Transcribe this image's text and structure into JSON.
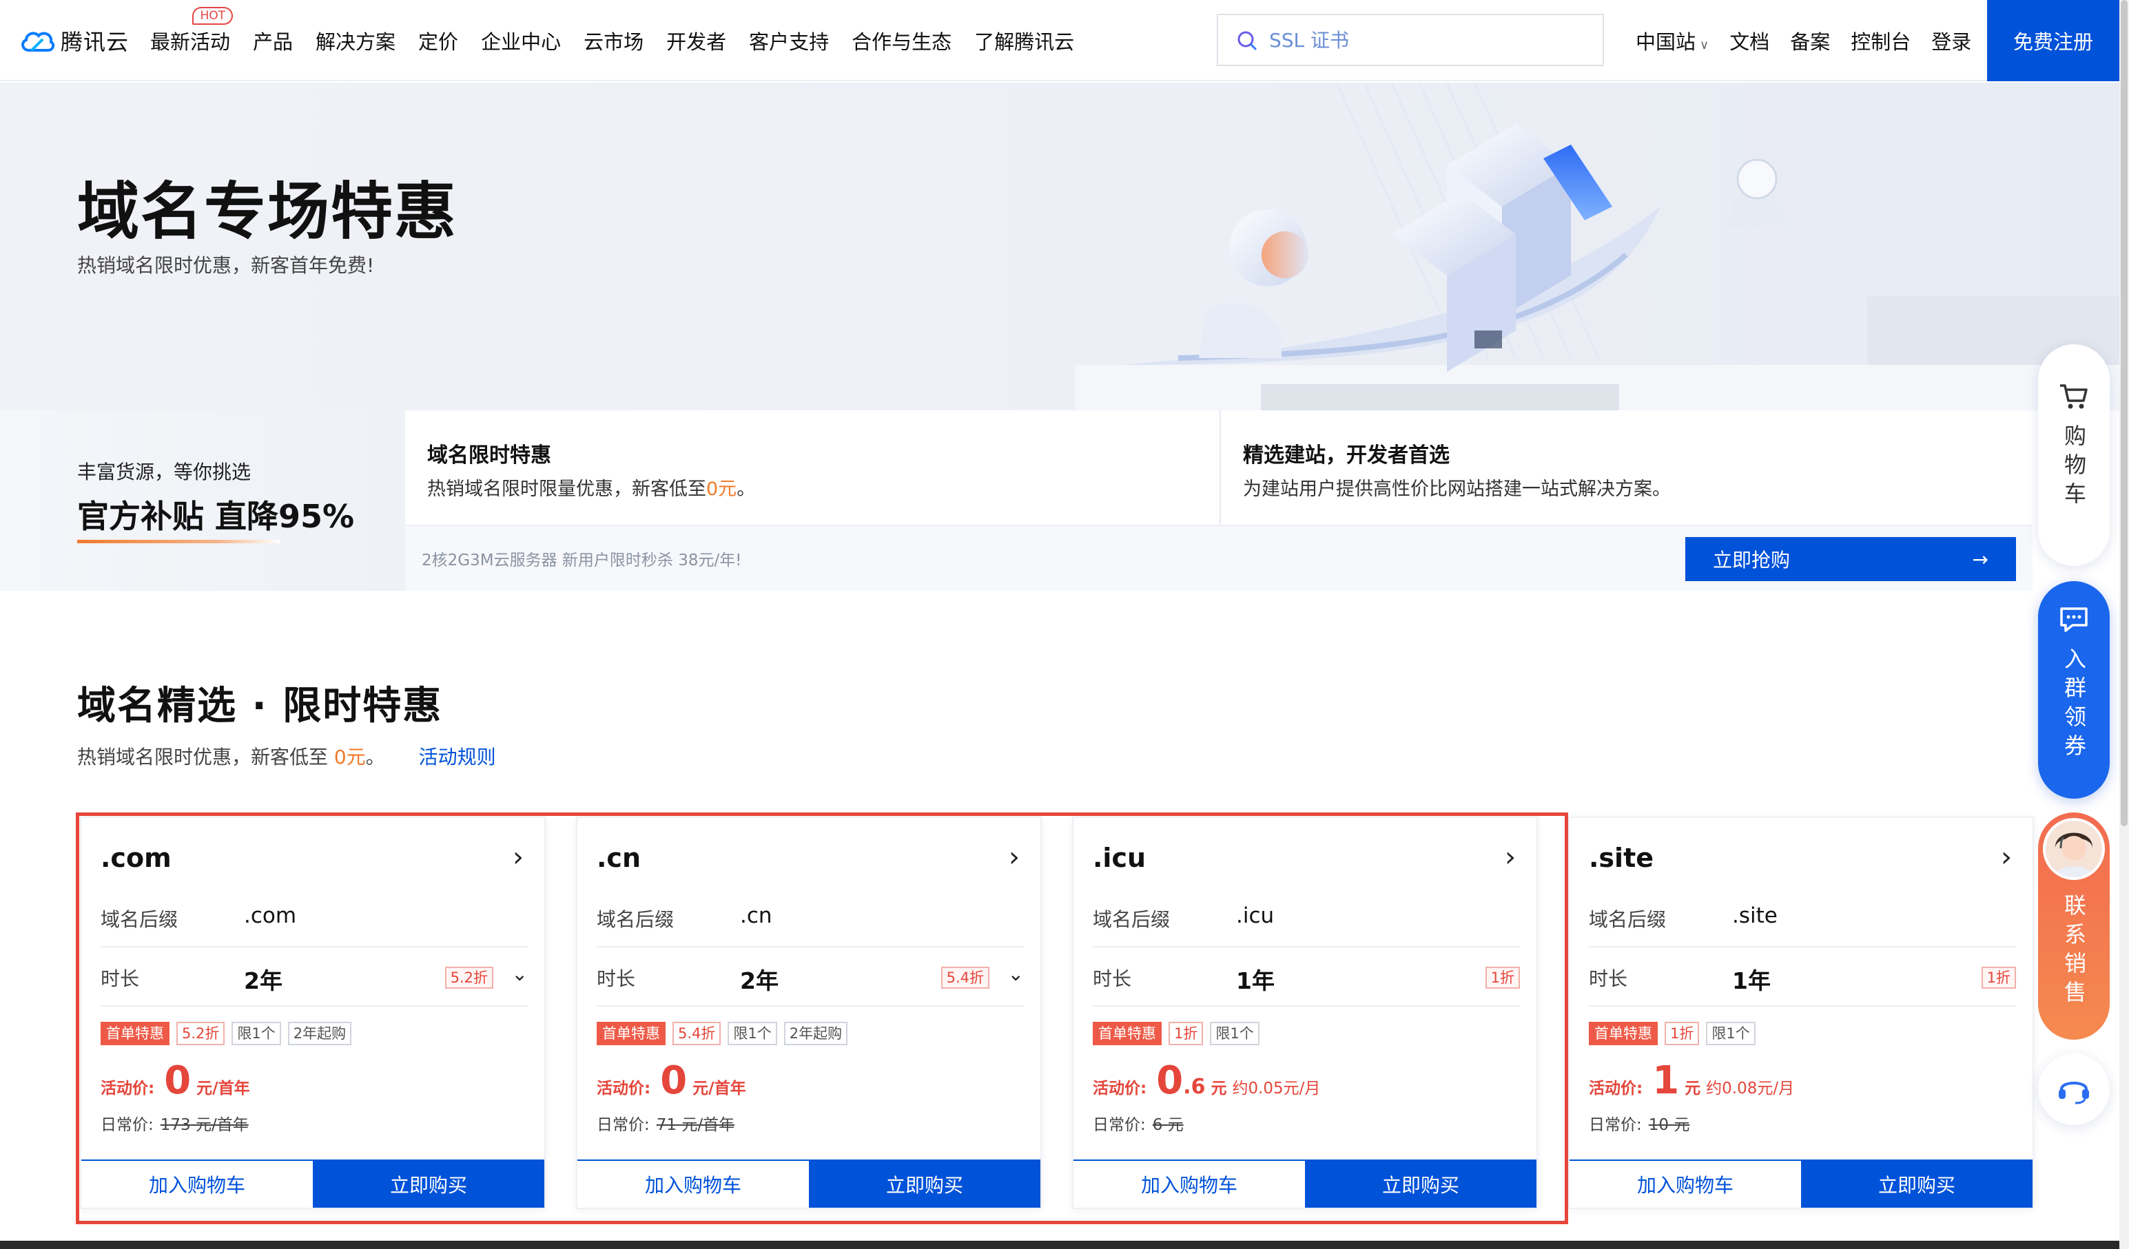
{
  "header": {
    "logo_text": "腾讯云",
    "nav": [
      "最新活动",
      "产品",
      "解决方案",
      "定价",
      "企业中心",
      "云市场",
      "开发者",
      "客户支持",
      "合作与生态",
      "了解腾讯云"
    ],
    "hot_badge": "HOT",
    "search_placeholder": "SSL 证书",
    "region": "中国站",
    "docs": "文档",
    "beian": "备案",
    "console": "控制台",
    "login": "登录",
    "register": "免费注册"
  },
  "banner": {
    "title": "域名专场特惠",
    "subtitle": "热销域名限时优惠，新客首年免费!"
  },
  "strip": {
    "left_small": "丰富货源，等你挑选",
    "left_big": "官方补贴 直降95%",
    "promo1_title": "域名限时特惠",
    "promo1_desc_pre": "热销域名限时限量优惠，新客低至",
    "promo1_desc_hl": "0元",
    "promo1_desc_post": "。",
    "promo2_title": "精选建站，开发者首选",
    "promo2_desc": "为建站用户提供高性价比网站搭建一站式解决方案。",
    "flash_text": "2核2G3M云服务器 新用户限时秒杀 38元/年!",
    "flash_btn": "立即抢购",
    "flash_arrow": "→"
  },
  "section": {
    "title": "域名精选 · 限时特惠",
    "sub_pre": "热销域名限时优惠，新客低至",
    "sub_hl": "0元",
    "sub_post": "。",
    "rules_link": "活动规则"
  },
  "labels": {
    "suffix": "域名后缀",
    "duration": "时长",
    "activity_price": "活动价:",
    "normal_price": "日常价:",
    "add_cart": "加入购物车",
    "buy_now": "立即购买",
    "tag_first": "首单特惠"
  },
  "cards": [
    {
      "name": ".com",
      "suffix": ".com",
      "duration": "2年",
      "discount": "5.2折",
      "tags": [
        "5.2折",
        "限1个",
        "2年起购"
      ],
      "price_int": "0",
      "price_dec": "",
      "price_unit": "元/首年",
      "per_month": "",
      "normal_value": "173",
      "normal_unit": "元/首年",
      "has_dropdown": true
    },
    {
      "name": ".cn",
      "suffix": ".cn",
      "duration": "2年",
      "discount": "5.4折",
      "tags": [
        "5.4折",
        "限1个",
        "2年起购"
      ],
      "price_int": "0",
      "price_dec": "",
      "price_unit": "元/首年",
      "per_month": "",
      "normal_value": "71",
      "normal_unit": "元/首年",
      "has_dropdown": true
    },
    {
      "name": ".icu",
      "suffix": ".icu",
      "duration": "1年",
      "discount": "1折",
      "tags": [
        "1折",
        "限1个"
      ],
      "price_int": "0",
      "price_dec": ".6",
      "price_unit": "元",
      "per_month": "约0.05元/月",
      "normal_value": "6",
      "normal_unit": "元",
      "has_dropdown": false
    },
    {
      "name": ".site",
      "suffix": ".site",
      "duration": "1年",
      "discount": "1折",
      "tags": [
        "1折",
        "限1个"
      ],
      "price_int": "1",
      "price_dec": "",
      "price_unit": "元",
      "per_month": "约0.08元/月",
      "normal_value": "10",
      "normal_unit": "元",
      "has_dropdown": false
    }
  ],
  "side": {
    "cart": "购物车",
    "group": "入群领券",
    "sales": "联系销售"
  },
  "colors": {
    "brand_blue": "#0052d9",
    "accent_orange": "#f07a2b",
    "price_red": "#e5463b",
    "outline_red": "#e5463b"
  }
}
